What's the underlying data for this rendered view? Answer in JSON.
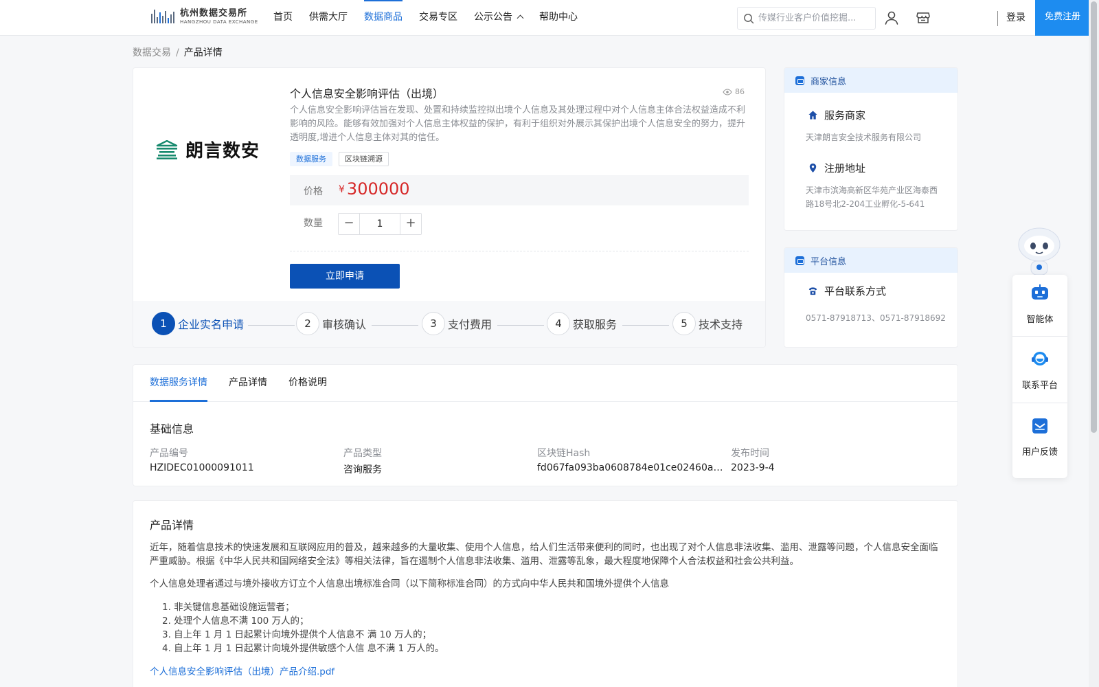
{
  "header": {
    "logo_cn": "杭州数据交易所",
    "logo_en": "HANGZHOU DATA EXCHANGE",
    "nav": [
      {
        "label": "首页"
      },
      {
        "label": "供需大厅"
      },
      {
        "label": "数据商品"
      },
      {
        "label": "交易专区"
      },
      {
        "label": "公示公告"
      },
      {
        "label": "帮助中心"
      }
    ],
    "search_placeholder": "传媒行业客户价值挖掘...",
    "login": "登录",
    "register": "免费注册"
  },
  "breadcrumb": {
    "root": "数据交易",
    "separator": "/",
    "current": "产品详情"
  },
  "product": {
    "brand_name": "朗言数安",
    "title": "个人信息安全影响评估（出境）",
    "views": "86",
    "description": "个人信息安全影响评估旨在发现、处置和持续监控拟出境个人信息及其处理过程中对个人信息主体合法权益造成不利影响的风险。能够有效加强对个人信息主体权益的保护，有利于组织对外展示其保护出境个人信息安全的努力，提升透明度,增进个人信息主体对其的信任。",
    "tags": [
      "数据服务",
      "区块链溯源"
    ],
    "price_label": "价格",
    "currency": "¥",
    "price": "300000",
    "quantity_label": "数量",
    "quantity": "1",
    "apply_label": "立即申请",
    "steps": [
      {
        "num": "1",
        "label": "企业实名申请"
      },
      {
        "num": "2",
        "label": "审核确认"
      },
      {
        "num": "3",
        "label": "支付费用"
      },
      {
        "num": "4",
        "label": "获取服务"
      },
      {
        "num": "5",
        "label": "技术支持"
      }
    ]
  },
  "merchant": {
    "header": "商家信息",
    "service_label": "服务商家",
    "service_value": "天津朗言安全技术服务有限公司",
    "address_label": "注册地址",
    "address_value": "天津市滨海高新区华苑产业区海泰西路18号北2-204工业孵化-5-641"
  },
  "platform": {
    "header": "平台信息",
    "contact_label": "平台联系方式",
    "contact_value": "0571-87918713、0571-87918692"
  },
  "tabs": [
    {
      "label": "数据服务详情"
    },
    {
      "label": "产品详情"
    },
    {
      "label": "价格说明"
    }
  ],
  "basic_info": {
    "title": "基础信息",
    "fields": [
      {
        "label": "产品编号",
        "value": "HZIDEC01000091011"
      },
      {
        "label": "产品类型",
        "value": "咨询服务"
      },
      {
        "label": "区块链Hash",
        "value": "fd067fa093ba0608784e01ce02460a253bc..."
      },
      {
        "label": "发布时间",
        "value": "2023-9-4"
      }
    ]
  },
  "intro": {
    "title": "产品详情",
    "p1": "近年，随着信息技术的快速发展和互联网应用的普及，越来越多的大量收集、使用个人信息，给人们生活带来便利的同时，也出现了对个人信息非法收集、滥用、泄露等问题，个人信息安全面临严重威胁。根据《中华人民共和国网络安全法》等相关法律，旨在遏制个人信息非法收集、滥用、泄露等乱象，最大程度地保障个人合法权益和社会公共利益。",
    "p2": "个人信息处理者通过与境外接收方订立个人信息出境标准合同（以下简称标准合同）的方式向中华人民共和国境外提供个人信息",
    "list": [
      "1. 非关键信息基础设施运营者；",
      "2. 处理个人信息不满 100 万人的；",
      "3. 自上年 1 月 1 日起累计向境外提供个人信息不 满 10 万人的；",
      "4. 自上年 1 月 1 日起累计向境外提供敏感个人信 息不满 1 万人的。"
    ],
    "link": "个人信息安全影响评估（出境）产品介绍.pdf"
  },
  "floating": {
    "items": [
      {
        "label": "智能体"
      },
      {
        "label": "联系平台"
      },
      {
        "label": "用户反馈"
      }
    ]
  }
}
